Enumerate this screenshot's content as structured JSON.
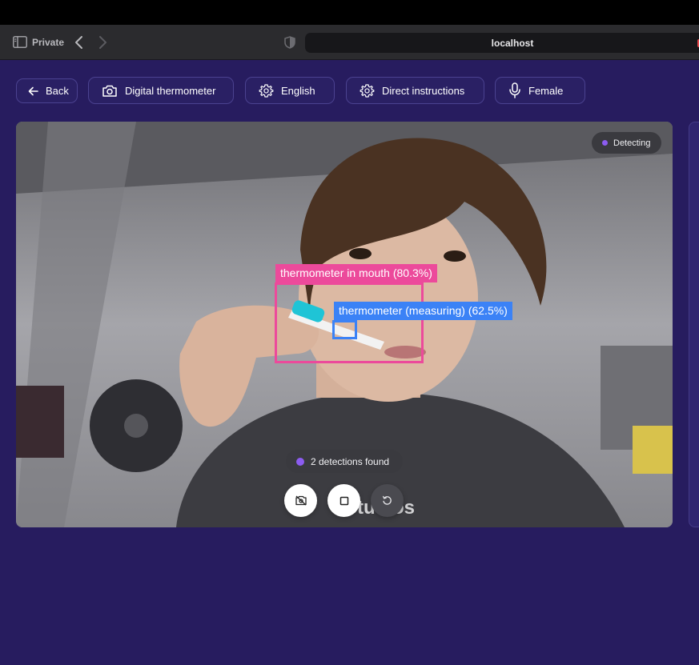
{
  "browser": {
    "private_label": "Private",
    "url": "localhost"
  },
  "toolbar": {
    "back_label": "Back",
    "device_label": "Digital thermometer",
    "language_label": "English",
    "mode_label": "Direct instructions",
    "voice_label": "Female"
  },
  "camera": {
    "status_label": "Detecting",
    "detections": [
      {
        "label": "thermometer in mouth (80.3%)",
        "color": "#ec4a9b"
      },
      {
        "label": "thermometer (measuring) (62.5%)",
        "color": "#3b82f6"
      }
    ],
    "detections_summary": "2 detections found"
  },
  "controls": {
    "camera_off_icon": "camera-off-icon",
    "stop_icon": "stop-icon",
    "reset_icon": "reset-icon"
  },
  "colors": {
    "background": "#271c5f",
    "accent": "#8c5cf0"
  }
}
